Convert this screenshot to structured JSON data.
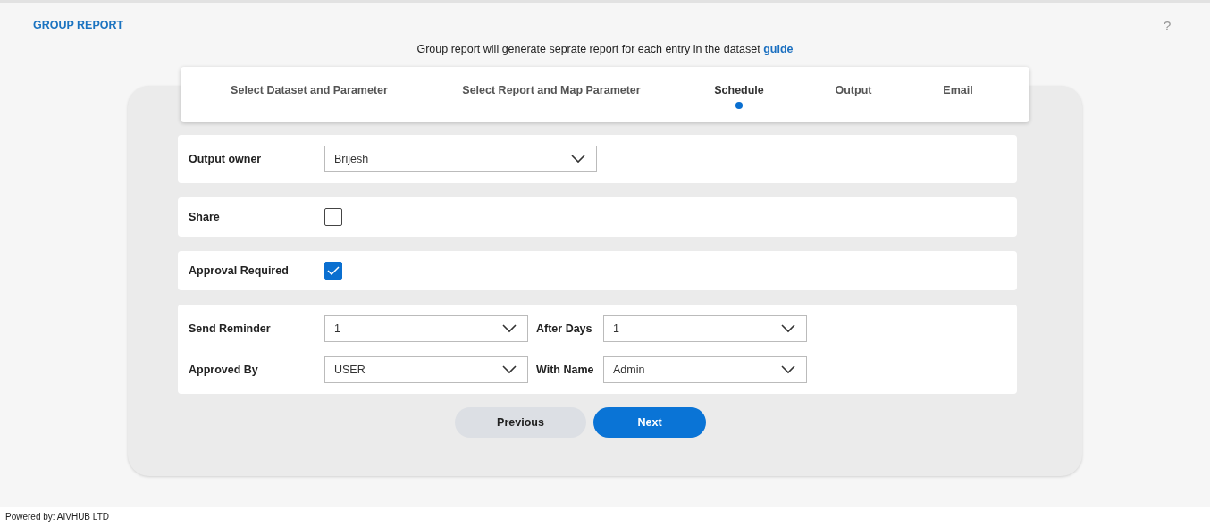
{
  "header": {
    "title": "GROUP REPORT",
    "help": "?"
  },
  "intro": {
    "text": "Group report will generate seprate report for each entry in the dataset",
    "link": "guide"
  },
  "steps": [
    {
      "label": "Select Dataset and Parameter",
      "selected": false
    },
    {
      "label": "Select Report and Map Parameter",
      "selected": false
    },
    {
      "label": "Schedule",
      "selected": true
    },
    {
      "label": "Output",
      "selected": false
    },
    {
      "label": "Email",
      "selected": false
    }
  ],
  "rows": [
    {
      "kind": "select",
      "label": "Output owner",
      "value": "Brijesh"
    },
    {
      "kind": "checkbox",
      "label": "Share",
      "checked": false
    },
    {
      "kind": "checkbox",
      "label": "Approval Required",
      "checked": true
    },
    {
      "kind": "grid",
      "lines": [
        [
          {
            "label": "Send Reminder",
            "value": "1"
          },
          {
            "label": "After Days",
            "value": "1"
          }
        ],
        [
          {
            "label": "Approved By",
            "value": "USER"
          },
          {
            "label": "With Name",
            "value": "Admin"
          }
        ]
      ]
    }
  ],
  "buttons": [
    {
      "kind": "secondary",
      "label": "Previous"
    },
    {
      "kind": "primary",
      "label": "Next"
    }
  ],
  "footer": "Powered by: AIVHUB LTD"
}
